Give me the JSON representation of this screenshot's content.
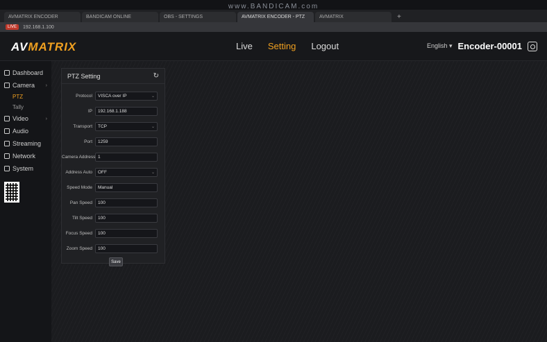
{
  "watermark": "www.BANDICAM.com",
  "browser": {
    "tabs": [
      {
        "label": "AVMATRIX ENCODER",
        "active": false
      },
      {
        "label": "BANDICAM ONLINE",
        "active": false
      },
      {
        "label": "OBS - SETTINGS",
        "active": false
      },
      {
        "label": "AVMATRIX ENCODER - PTZ",
        "active": true
      },
      {
        "label": "AVMATRIX",
        "active": false
      }
    ],
    "new_tab": "+",
    "address_badge": "LIVE",
    "address": "192.168.1.100"
  },
  "header": {
    "logo_main": "AV",
    "logo_accent": "MATRIX",
    "nav": [
      {
        "label": "Live",
        "active": false
      },
      {
        "label": "Setting",
        "active": true
      },
      {
        "label": "Logout",
        "active": false
      }
    ],
    "language": "English ▾",
    "device_name": "Encoder-00001"
  },
  "sidebar": {
    "items": [
      {
        "label": "Dashboard",
        "icon": "dashboard-icon",
        "expandable": false
      },
      {
        "label": "Camera",
        "icon": "camera-icon",
        "expandable": true
      },
      {
        "label": "Video",
        "icon": "video-icon",
        "expandable": true
      },
      {
        "label": "Audio",
        "icon": "audio-icon",
        "expandable": false
      },
      {
        "label": "Streaming",
        "icon": "streaming-icon",
        "expandable": false
      },
      {
        "label": "Network",
        "icon": "network-icon",
        "expandable": false
      },
      {
        "label": "System",
        "icon": "system-icon",
        "expandable": false
      }
    ],
    "camera_sub": [
      {
        "label": "PTZ",
        "active": true
      },
      {
        "label": "Tally",
        "active": false
      }
    ],
    "accent_color": "#f0a020"
  },
  "ptz": {
    "title": "PTZ Setting",
    "fields": [
      {
        "label": "Protocol",
        "value": "VISCA over IP",
        "dropdown": true
      },
      {
        "label": "IP",
        "value": "192.168.1.188",
        "dropdown": false
      },
      {
        "label": "Transport",
        "value": "TCP",
        "dropdown": true
      },
      {
        "label": "Port",
        "value": "1259",
        "dropdown": false
      },
      {
        "label": "Camera Address",
        "value": "1",
        "dropdown": false
      },
      {
        "label": "Address Auto",
        "value": "OFF",
        "dropdown": true
      },
      {
        "label": "Speed Mode",
        "value": "Manual",
        "dropdown": false
      },
      {
        "label": "Pan Speed",
        "value": "100",
        "dropdown": false
      },
      {
        "label": "Tilt Speed",
        "value": "100",
        "dropdown": false
      },
      {
        "label": "Focus Speed",
        "value": "100",
        "dropdown": false
      },
      {
        "label": "Zoom Speed",
        "value": "100",
        "dropdown": false
      }
    ],
    "save_label": "Save"
  }
}
